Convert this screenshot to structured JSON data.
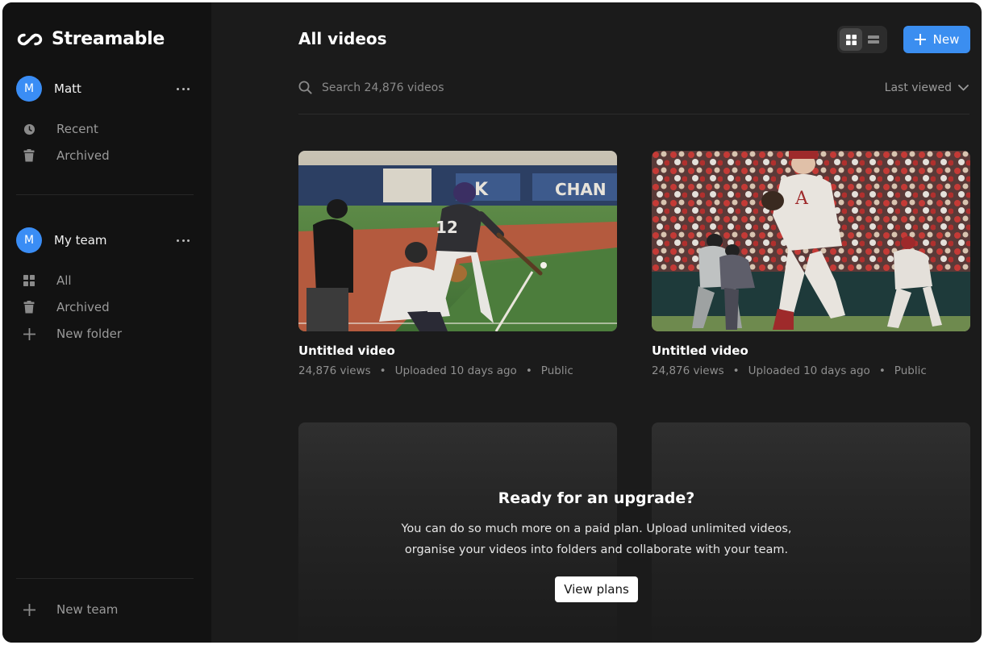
{
  "app": {
    "name": "Streamable"
  },
  "sidebar": {
    "personal": {
      "avatar_initial": "M",
      "name": "Matt",
      "items": [
        {
          "label": "Recent",
          "icon": "clock-icon"
        },
        {
          "label": "Archived",
          "icon": "trash-icon"
        }
      ]
    },
    "team": {
      "avatar_initial": "M",
      "name": "My team",
      "items": [
        {
          "label": "All",
          "icon": "grid-icon"
        },
        {
          "label": "Archived",
          "icon": "trash-icon"
        },
        {
          "label": "New folder",
          "icon": "plus-icon"
        }
      ]
    },
    "new_team_label": "New team"
  },
  "main": {
    "title": "All videos",
    "new_button_label": "New",
    "search_placeholder": "Search 24,876 videos",
    "sort_label": "Last viewed",
    "view_mode": "grid",
    "videos": [
      {
        "title": "Untitled video",
        "views": "24,876 views",
        "uploaded": "Uploaded 10 days ago",
        "visibility": "Public",
        "thumbnail": "baseball batter swinging at home plate"
      },
      {
        "title": "Untitled video",
        "views": "24,876 views",
        "uploaded": "Uploaded 10 days ago",
        "visibility": "Public",
        "thumbnail": "baseball pitcher mid-delivery in stadium"
      }
    ],
    "upgrade": {
      "title": "Ready for an upgrade?",
      "body": "You can do so much more on a paid plan. Upload unlimited videos, organise your videos into folders and collaborate with your team.",
      "button_label": "View plans"
    }
  },
  "colors": {
    "accent": "#3b8ef0",
    "avatar": "#3a8df5",
    "background": "#1b1b1b",
    "sidebar": "#121212"
  }
}
